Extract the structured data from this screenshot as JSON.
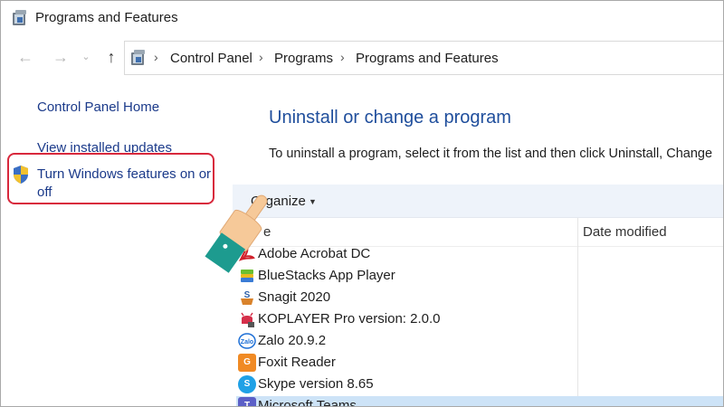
{
  "window": {
    "title": "Programs and Features"
  },
  "nav": {
    "back_icon": "arrow-left-icon",
    "forward_icon": "arrow-right-icon",
    "recent_icon": "chevron-down-icon",
    "up_icon": "arrow-up-icon",
    "breadcrumbs": [
      "Control Panel",
      "Programs",
      "Programs and Features"
    ]
  },
  "sidebar": {
    "home": "Control Panel Home",
    "updates": "View installed updates",
    "features": "Turn Windows features on or off"
  },
  "main": {
    "heading": "Uninstall or change a program",
    "instructions": "To uninstall a program, select it from the list and then click Uninstall, Change",
    "organize_label": "Organize",
    "columns": {
      "name": "e",
      "date": "Date modified"
    },
    "programs": [
      {
        "name": "Adobe Acrobat DC",
        "icon": "acrobat-icon"
      },
      {
        "name": "BlueStacks App Player",
        "icon": "bluestacks-icon"
      },
      {
        "name": "Snagit 2020",
        "icon": "snagit-icon"
      },
      {
        "name": "KOPLAYER Pro version: 2.0.0",
        "icon": "koplayer-icon"
      },
      {
        "name": "Zalo 20.9.2",
        "icon": "zalo-icon"
      },
      {
        "name": "Foxit Reader",
        "icon": "foxit-icon"
      },
      {
        "name": "Skype version 8.65",
        "icon": "skype-icon"
      },
      {
        "name": "Microsoft Teams",
        "icon": "teams-icon"
      }
    ]
  },
  "colors": {
    "link": "#1b3a8a",
    "heading": "#1f4e9c",
    "highlight": "#d8283c",
    "toolbar_bg": "#eef3fa",
    "selected_row": "#cde3f7"
  }
}
